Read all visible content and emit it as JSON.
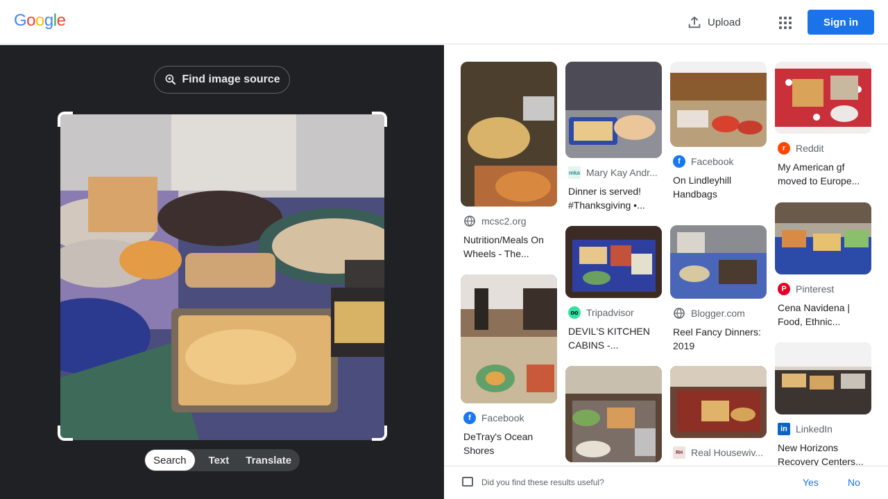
{
  "header": {
    "logo": [
      "G",
      "o",
      "o",
      "g",
      "l",
      "e"
    ],
    "upload_label": "Upload",
    "signin_label": "Sign in"
  },
  "lens": {
    "find_source_label": "Find image source",
    "modes": [
      "Search",
      "Text",
      "Translate"
    ],
    "active_mode": "Search"
  },
  "results": [
    {
      "source": "mcsc2.org",
      "title": "Nutrition/Meals On Wheels - The...",
      "icon": "globe-icon"
    },
    {
      "source": "Facebook",
      "title": "DeTray's Ocean Shores",
      "icon": "facebook-icon"
    },
    {
      "source": "Mary Kay Andr...",
      "title": "Dinner is served! #Thanksgiving •...",
      "icon": "mka-icon"
    },
    {
      "source": "Tripadvisor",
      "title": "DEVIL'S KITCHEN CABINS -...",
      "icon": "tripadvisor-icon"
    },
    {
      "source": "Facebook",
      "title": "On Lindleyhill Handbags",
      "icon": "facebook-icon"
    },
    {
      "source": "Blogger.com",
      "title": "Reel Fancy Dinners: 2019",
      "icon": "globe-icon"
    },
    {
      "source": "Real Housewiv...",
      "title": "",
      "icon": "rhn-icon"
    },
    {
      "source": "Reddit",
      "title": "My American gf moved to Europe...",
      "icon": "reddit-icon"
    },
    {
      "source": "Pinterest",
      "title": "Cena Navidena | Food, Ethnic...",
      "icon": "pinterest-icon"
    },
    {
      "source": "LinkedIn",
      "title": "New Horizons Recovery Centers...",
      "icon": "linkedin-icon"
    }
  ],
  "feedback": {
    "question": "Did you find these results useful?",
    "yes": "Yes",
    "no": "No"
  },
  "colors": {
    "accent": "#1a73e8",
    "dark_panel": "#202124"
  }
}
